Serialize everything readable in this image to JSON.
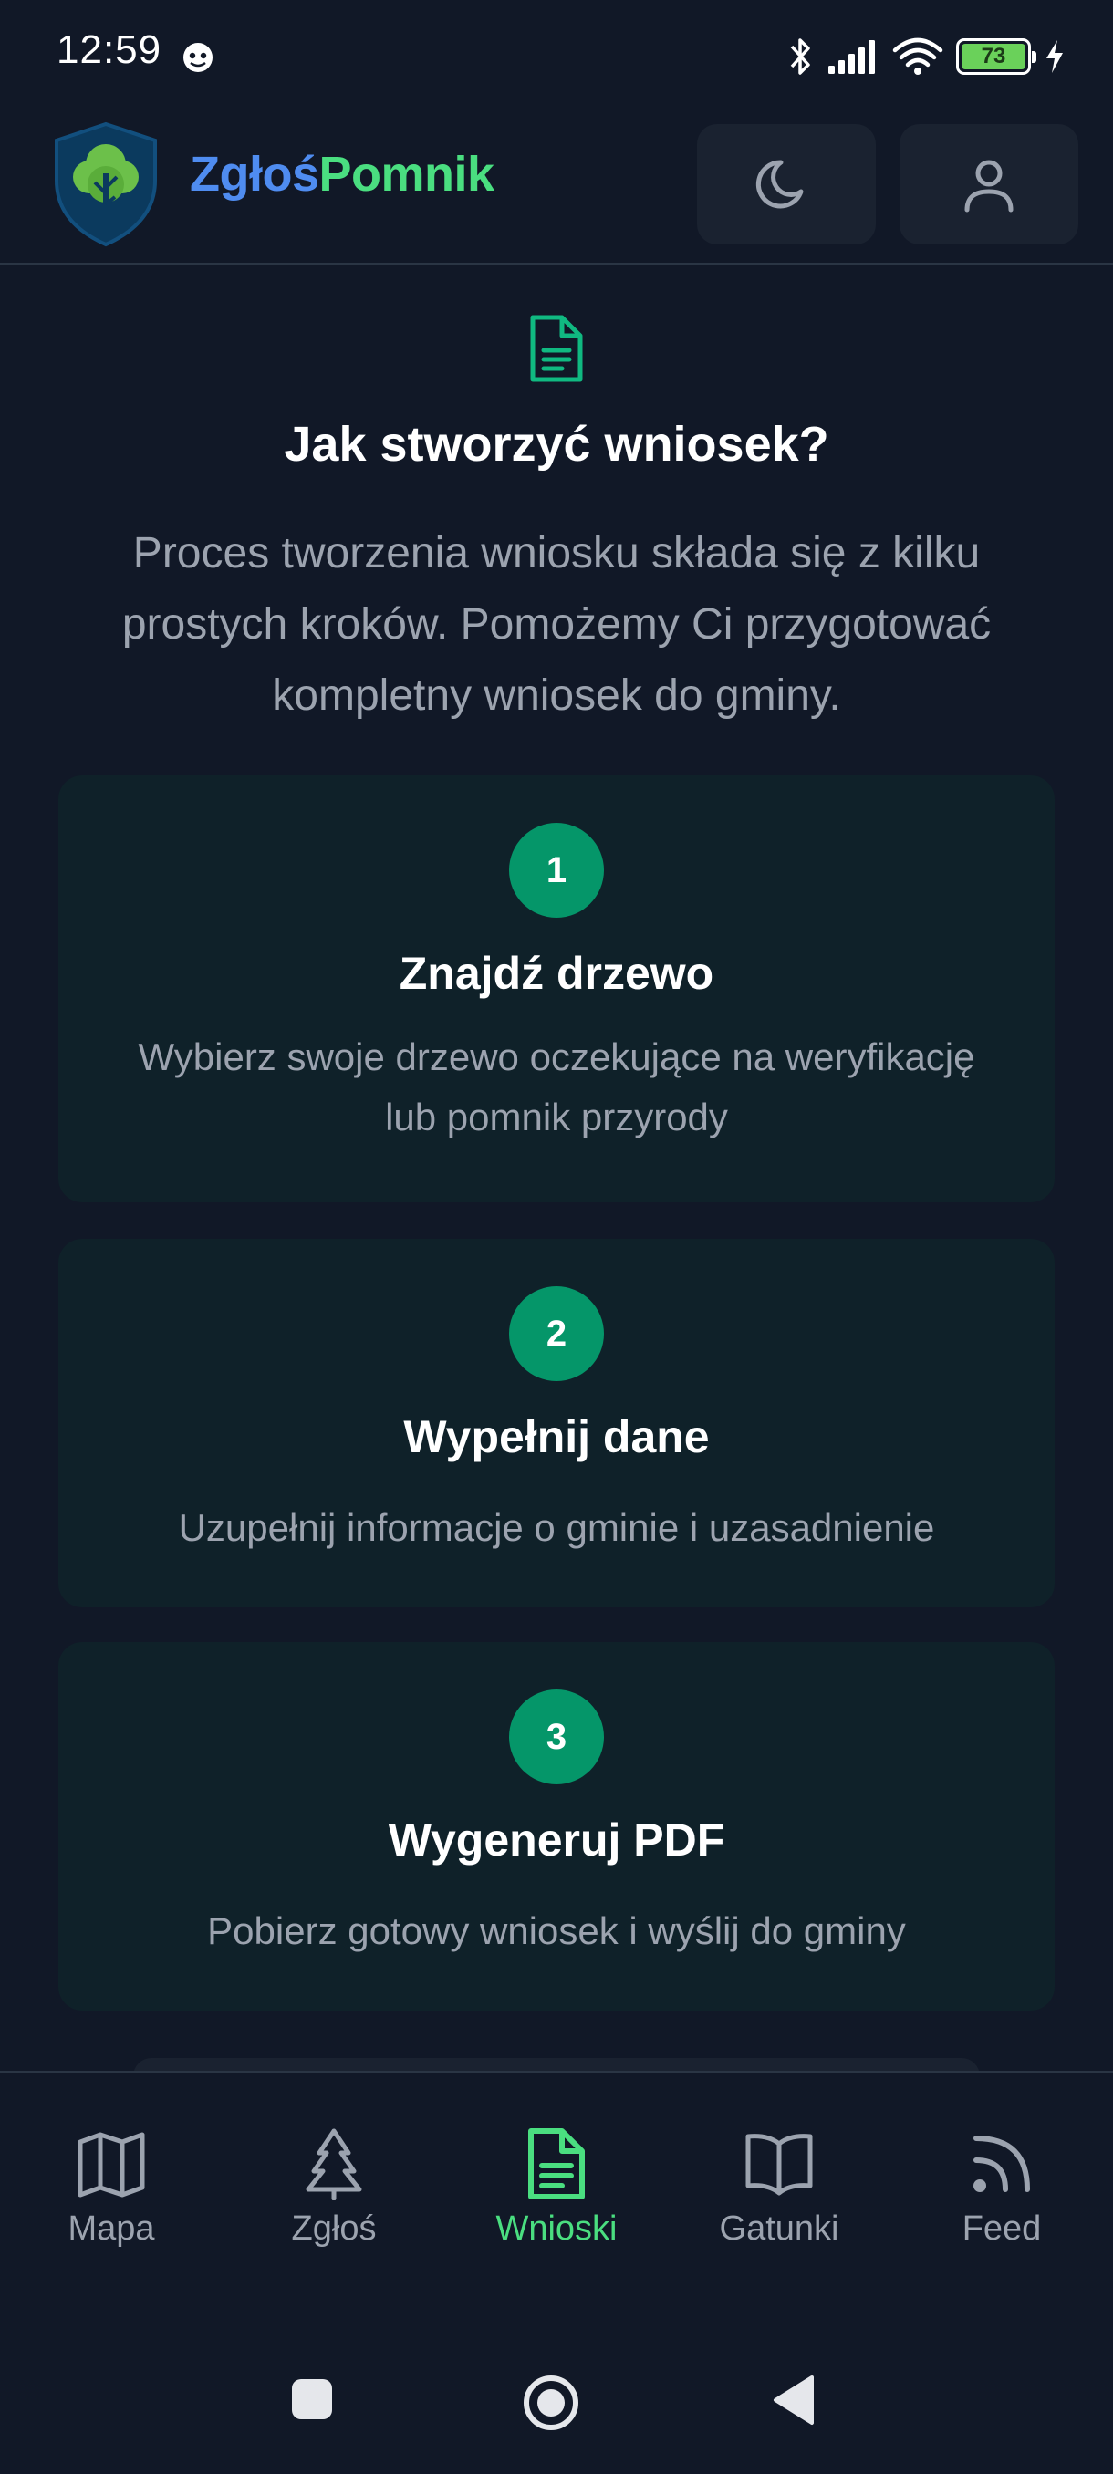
{
  "status_bar": {
    "time": "12:59",
    "battery_level": "73",
    "icons": [
      "notification-icon",
      "bluetooth-icon",
      "signal-icon",
      "wifi-icon",
      "battery-icon",
      "charging-icon"
    ]
  },
  "header": {
    "brand_part1": "Zgłoś",
    "brand_part2": "Pomnik",
    "buttons": [
      "moon-icon",
      "user-icon"
    ]
  },
  "main": {
    "title": "Jak stworzyć wniosek?",
    "intro": "Proces tworzenia wniosku składa się z kilku prostych kroków. Pomożemy Ci przygotować kompletny wniosek do gminy.",
    "steps": [
      {
        "number": "1",
        "title": "Znajdź drzewo",
        "description": "Wybierz swoje drzewo oczekujące na weryfikację lub pomnik przyrody"
      },
      {
        "number": "2",
        "title": "Wypełnij dane",
        "description": "Uzupełnij informacje o gminie i uzasadnienie"
      },
      {
        "number": "3",
        "title": "Wygeneruj PDF",
        "description": "Pobierz gotowy wniosek i wyślij do gminy"
      }
    ]
  },
  "bottom_nav": {
    "items": [
      {
        "label": "Mapa",
        "icon": "map-icon",
        "active": false
      },
      {
        "label": "Zgłoś",
        "icon": "tree-icon",
        "active": false
      },
      {
        "label": "Wnioski",
        "icon": "document-icon",
        "active": true
      },
      {
        "label": "Gatunki",
        "icon": "book-icon",
        "active": false
      },
      {
        "label": "Feed",
        "icon": "rss-icon",
        "active": false
      }
    ]
  },
  "colors": {
    "background": "#111827",
    "card": "#0f2129",
    "accent": "#059669",
    "accent_light": "#4ade80",
    "brand_blue": "#4f8cf0",
    "muted_text": "#9ca3af"
  }
}
